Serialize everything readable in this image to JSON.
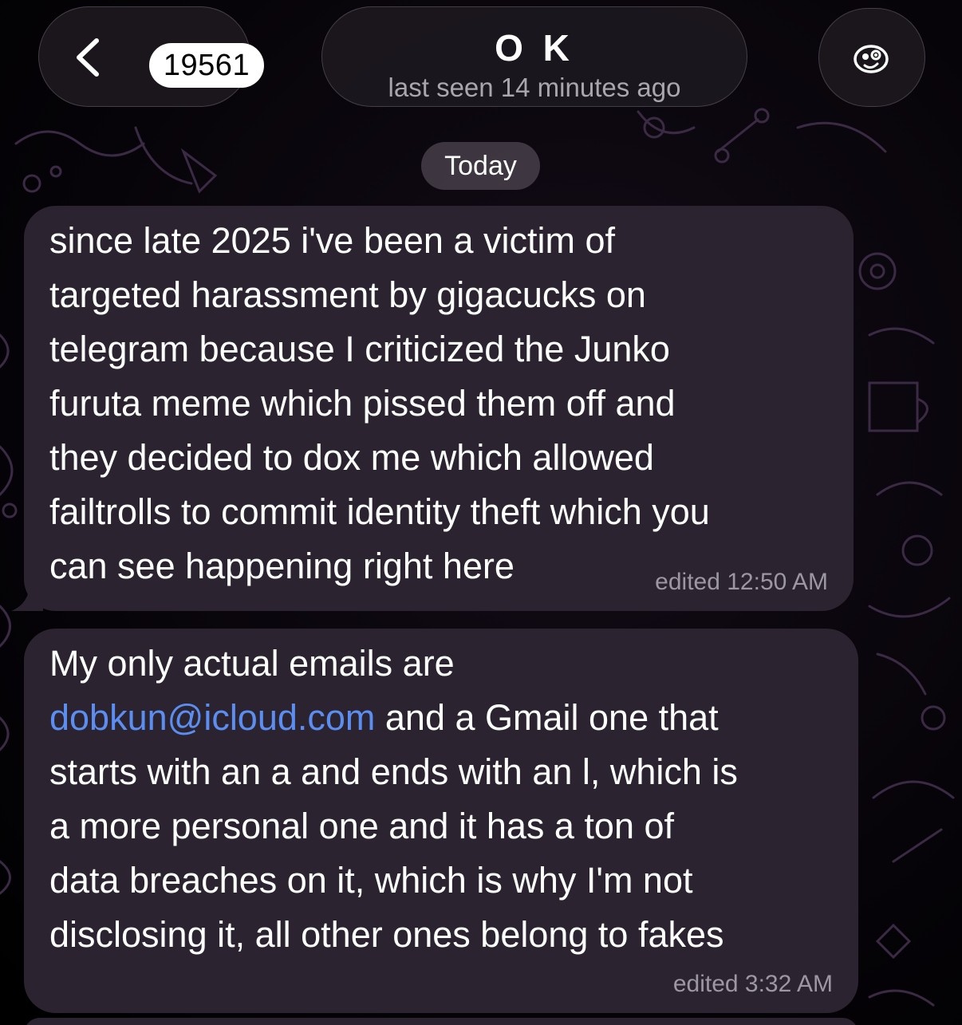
{
  "header": {
    "unread_count": "19561",
    "title": "O K",
    "status": "last seen 14 minutes ago",
    "back_icon": "chevron-left-icon",
    "avatar_icon": "sticker-face-icon"
  },
  "date_chip": "Today",
  "messages": [
    {
      "text": "since late 2025 i've been a victim of\ntargeted harassment by gigacucks on\ntelegram because I criticized the Junko\nfuruta meme which pissed them off and\nthey decided to dox me which allowed\nfailtrolls to commit identity theft which you\ncan see happening right here",
      "meta": "edited 12:50 AM"
    },
    {
      "text_before_link": "My only actual emails are\n",
      "link": "dobkun@icloud.com",
      "text_after_link": " and a Gmail one that\nstarts with an a and ends with an l, which is\na more personal one and it has a ton of\ndata breaches on it, which is why I'm not\ndisclosing it, all other ones belong to fakes",
      "meta": "edited 3:32 AM"
    }
  ],
  "colors": {
    "bubble": "#2b2430",
    "link": "#5b8ef0",
    "meta": "#9d97a3",
    "wallpaper_lines": "#3a2a44"
  }
}
